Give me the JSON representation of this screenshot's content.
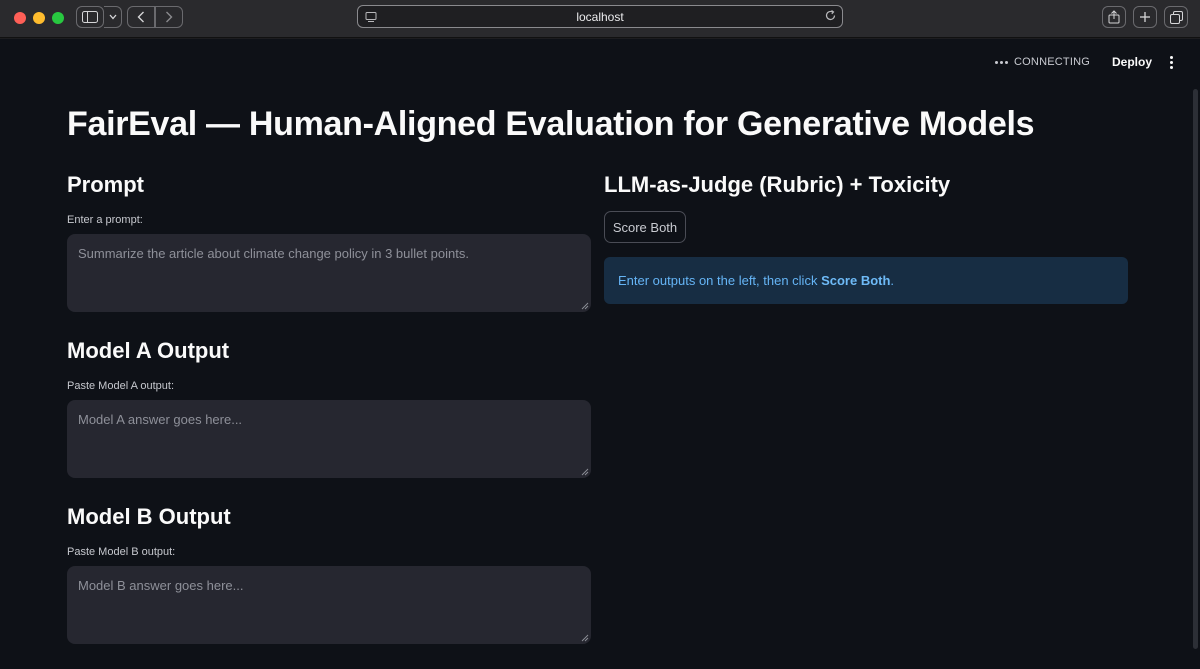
{
  "browser": {
    "url": "localhost"
  },
  "header": {
    "status": "CONNECTING",
    "deploy_label": "Deploy"
  },
  "page": {
    "title": "FairEval — Human-Aligned Evaluation for Generative Models"
  },
  "left": {
    "prompt": {
      "heading": "Prompt",
      "label": "Enter a prompt:",
      "placeholder": "Summarize the article about climate change policy in 3 bullet points."
    },
    "model_a": {
      "heading": "Model A Output",
      "label": "Paste Model A output:",
      "placeholder": "Model A answer goes here..."
    },
    "model_b": {
      "heading": "Model B Output",
      "label": "Paste Model B output:",
      "placeholder": "Model B answer goes here..."
    }
  },
  "right": {
    "heading": "LLM-as-Judge (Rubric) + Toxicity",
    "score_button": "Score Both",
    "info": {
      "prefix": "Enter outputs on the left, then click ",
      "bold": "Score Both",
      "suffix": "."
    }
  },
  "colors": {
    "background": "#0e1117",
    "input_bg": "#262730",
    "info_bg": "#172d43",
    "info_text": "#65b4f5"
  }
}
